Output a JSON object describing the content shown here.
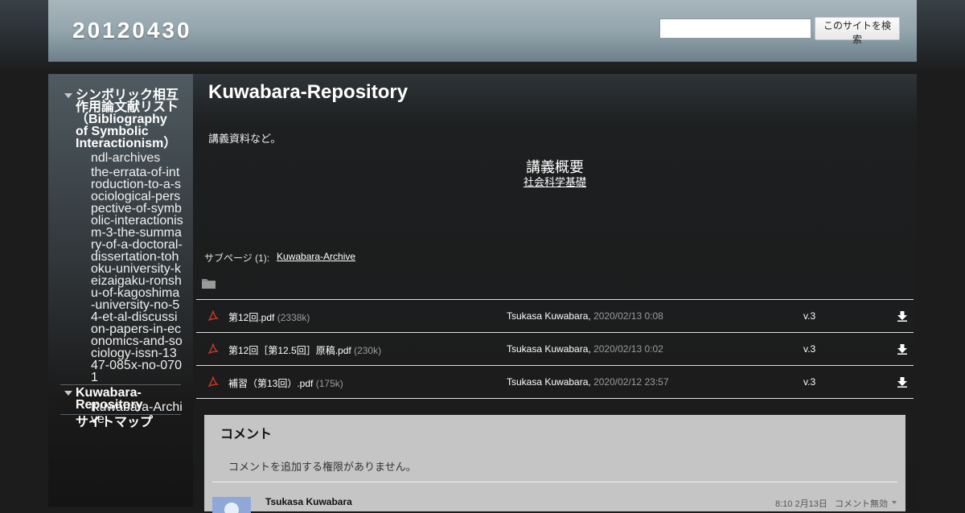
{
  "site": {
    "title": "20120430"
  },
  "search": {
    "placeholder": "",
    "button_label": "このサイトを検索"
  },
  "sidebar": {
    "section1": {
      "parent_label": "シンボリック相互作用論文献リスト（Bibliography of Symbolic Interactionism）",
      "children": [
        "ndl-archives",
        "the-errata-of-introduction-to-a-sociological-perspective-of-symbolic-interactionism-3-the-summary-of-a-doctoral-dissertation-tohoku-university-keizaigaku-ronshu-of-kagoshima-university-no-54-et-al-discussion-papers-in-economics-and-sociology-issn-1347-085x-no-0701"
      ]
    },
    "section2": {
      "parent_label": "Kuwabara-Repository",
      "children": [
        "Kuwabara-Archive"
      ]
    },
    "sitemap_label": "サイトマップ"
  },
  "main": {
    "title": "Kuwabara-Repository",
    "intro": "講義資料など。",
    "lecture_heading": "講義概要",
    "lecture_link": "社会科学基礎",
    "subpages_label": "サブページ (1):",
    "subpages_link": "Kuwabara-Archive"
  },
  "files": [
    {
      "name": "第12回.pdf",
      "size": "(2338k)",
      "author": "Tsukasa Kuwabara,",
      "date": "2020/02/13 0:08",
      "version": "v.3"
    },
    {
      "name": "第12回［第12.5回］原稿.pdf",
      "size": "(230k)",
      "author": "Tsukasa Kuwabara,",
      "date": "2020/02/13 0:02",
      "version": "v.3"
    },
    {
      "name": "補習（第13回）.pdf",
      "size": "(175k)",
      "author": "Tsukasa Kuwabara,",
      "date": "2020/02/12 23:57",
      "version": "v.3"
    }
  ],
  "comments": {
    "title": "コメント",
    "note": "コメントを追加する権限がありません。",
    "entry": {
      "author": "Tsukasa Kuwabara",
      "time": "8:10 2月13日",
      "disable_label": "コメント無効"
    }
  },
  "colors": {
    "header": "#94a5ad",
    "pdf_icon": "#c0392b",
    "comments_bg": "#c5c5c5"
  }
}
